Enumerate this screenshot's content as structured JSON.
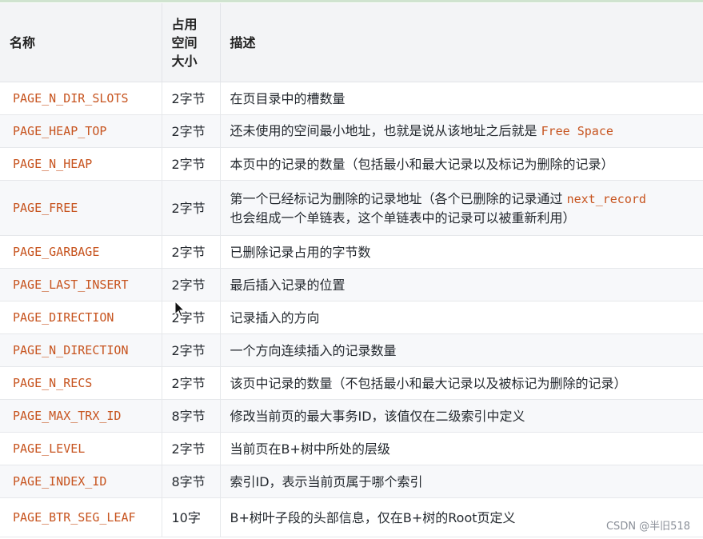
{
  "header": {
    "col_name": "名称",
    "col_size_line1": "占用",
    "col_size_line2": "空间",
    "col_size_line3": "大小",
    "col_desc": "描述"
  },
  "rows": [
    {
      "name": "PAGE_N_DIR_SLOTS",
      "size": "2字节",
      "desc": "在页目录中的槽数量"
    },
    {
      "name": "PAGE_HEAP_TOP",
      "size": "2字节",
      "desc_pre": "还未使用的空间最小地址，也就是说从该地址之后就是 ",
      "desc_code": "Free Space"
    },
    {
      "name": "PAGE_N_HEAP",
      "size": "2字节",
      "desc": "本页中的记录的数量（包括最小和最大记录以及标记为删除的记录）"
    },
    {
      "name": "PAGE_FREE",
      "size": "2字节",
      "desc_pre": "第一个已经标记为删除的记录地址（各个已删除的记录通过 ",
      "desc_code": "next_record",
      "desc_line2": "也会组成一个单链表，这个单链表中的记录可以被重新利用）"
    },
    {
      "name": "PAGE_GARBAGE",
      "size": "2字节",
      "desc": "已删除记录占用的字节数"
    },
    {
      "name": "PAGE_LAST_INSERT",
      "size": "2字节",
      "desc": "最后插入记录的位置"
    },
    {
      "name": "PAGE_DIRECTION",
      "size": "2字节",
      "desc": "记录插入的方向"
    },
    {
      "name": "PAGE_N_DIRECTION",
      "size": "2字节",
      "desc": "一个方向连续插入的记录数量"
    },
    {
      "name": "PAGE_N_RECS",
      "size": "2字节",
      "desc": "该页中记录的数量（不包括最小和最大记录以及被标记为删除的记录）"
    },
    {
      "name": "PAGE_MAX_TRX_ID",
      "size": "8字节",
      "desc": "修改当前页的最大事务ID，该值仅在二级索引中定义"
    },
    {
      "name": "PAGE_LEVEL",
      "size": "2字节",
      "desc": "当前页在B+树中所处的层级"
    },
    {
      "name": "PAGE_INDEX_ID",
      "size": "8字节",
      "desc": "索引ID，表示当前页属于哪个索引"
    },
    {
      "name": "PAGE_BTR_SEG_LEAF",
      "size": "10字",
      "desc": "B+树叶子段的头部信息，仅在B+树的Root页定义"
    }
  ],
  "watermark": "CSDN @半旧518",
  "colors": {
    "code": "#c7541f",
    "header_bg": "#f3f4f6"
  }
}
